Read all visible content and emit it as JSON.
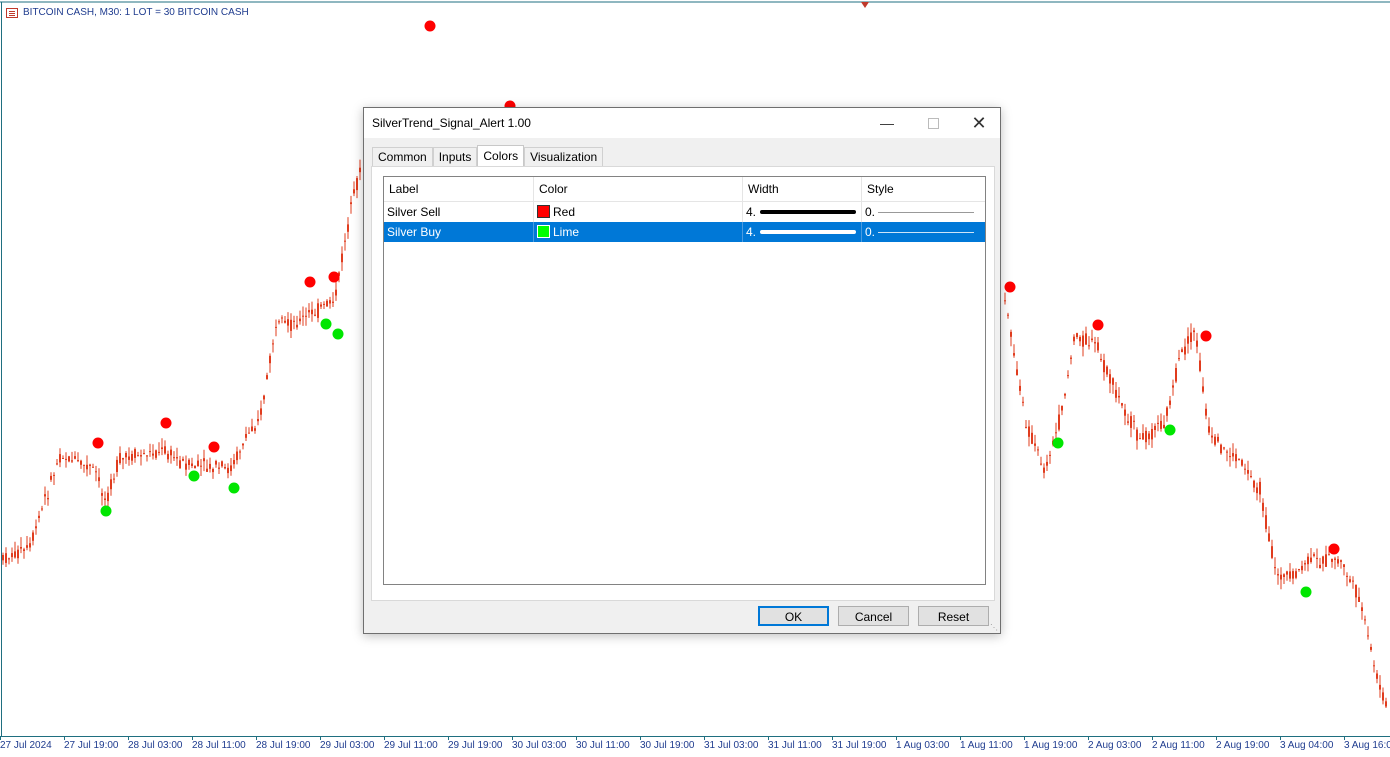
{
  "chart": {
    "title": "BITCOIN CASH, M30:  1 LOT = 30 BITCOIN CASH",
    "x_labels": [
      "27 Jul 2024",
      "27 Jul 19:00",
      "28 Jul 03:00",
      "28 Jul 11:00",
      "28 Jul 19:00",
      "29 Jul 03:00",
      "29 Jul 11:00",
      "29 Jul 19:00",
      "30 Jul 03:00",
      "30 Jul 11:00",
      "30 Jul 19:00",
      "31 Jul 03:00",
      "31 Jul 11:00",
      "31 Jul 19:00",
      "1 Aug 03:00",
      "1 Aug 11:00",
      "1 Aug 19:00",
      "2 Aug 03:00",
      "2 Aug 11:00",
      "2 Aug 19:00",
      "3 Aug 04:00",
      "3 Aug 16:00"
    ],
    "candle_color": "#e03c1e",
    "sell_dot_color": "#ff0000",
    "buy_dot_color": "#00e600",
    "axis_color": "#1f6f80"
  },
  "dialog": {
    "title": "SilverTrend_Signal_Alert 1.00",
    "tabs": [
      "Common",
      "Inputs",
      "Colors",
      "Visualization"
    ],
    "active_tab": "Colors",
    "columns": {
      "label": "Label",
      "color": "Color",
      "width": "Width",
      "style": "Style"
    },
    "rows": [
      {
        "label": "Silver Sell",
        "color_name": "Red",
        "color_hex": "#ff0000",
        "width": "4.",
        "style": "0.",
        "selected": false
      },
      {
        "label": "Silver Buy",
        "color_name": "Lime",
        "color_hex": "#00ff00",
        "width": "4.",
        "style": "0.",
        "selected": true
      }
    ],
    "buttons": {
      "ok": "OK",
      "cancel": "Cancel",
      "reset": "Reset"
    },
    "window_icons": [
      "minimize-icon",
      "maximize-icon",
      "close-icon"
    ]
  }
}
